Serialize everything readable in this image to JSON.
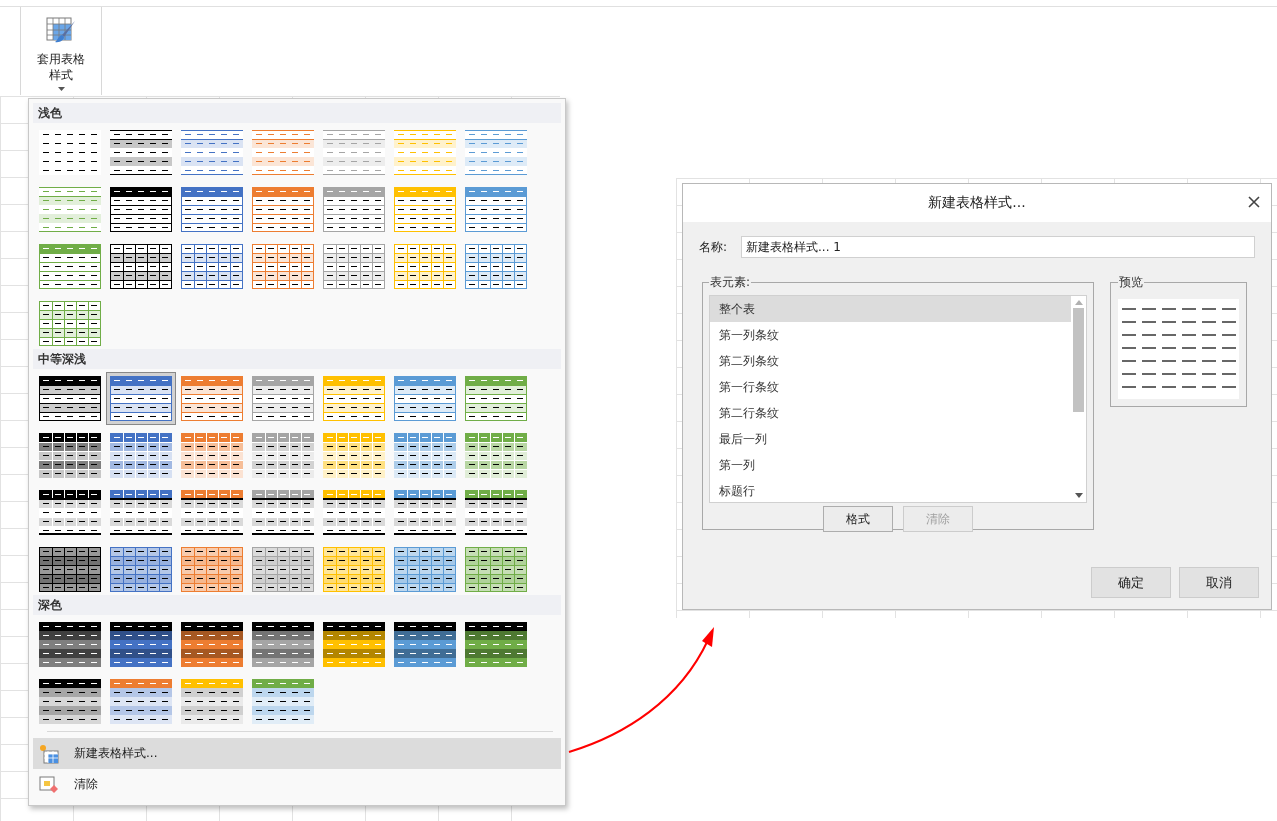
{
  "ribbon": {
    "button": {
      "label": "套用表格样式"
    }
  },
  "gallery": {
    "sections": [
      {
        "title": "浅色",
        "styles": [
          {
            "kind": "plain",
            "color": "#000000",
            "selected": false
          },
          {
            "kind": "light-banded",
            "color": "#000000",
            "selected": false
          },
          {
            "kind": "light-banded",
            "color": "#4472c4",
            "selected": false
          },
          {
            "kind": "light-banded",
            "color": "#ed7d31",
            "selected": false
          },
          {
            "kind": "light-banded",
            "color": "#a5a5a5",
            "selected": false
          },
          {
            "kind": "light-banded",
            "color": "#ffc000",
            "selected": false
          },
          {
            "kind": "light-banded",
            "color": "#5b9bd5",
            "selected": false
          },
          {
            "kind": "light-banded",
            "color": "#70ad47",
            "selected": false
          },
          {
            "kind": "lined",
            "color": "#000000",
            "selected": false
          },
          {
            "kind": "lined",
            "color": "#4472c4",
            "selected": false
          },
          {
            "kind": "lined",
            "color": "#ed7d31",
            "selected": false
          },
          {
            "kind": "lined",
            "color": "#a5a5a5",
            "selected": false
          },
          {
            "kind": "lined",
            "color": "#ffc000",
            "selected": false
          },
          {
            "kind": "lined",
            "color": "#5b9bd5",
            "selected": false
          },
          {
            "kind": "lined",
            "color": "#70ad47",
            "selected": false
          },
          {
            "kind": "grid",
            "color": "#000000",
            "selected": false
          },
          {
            "kind": "grid",
            "color": "#4472c4",
            "selected": false
          },
          {
            "kind": "grid",
            "color": "#ed7d31",
            "selected": false
          },
          {
            "kind": "grid",
            "color": "#a5a5a5",
            "selected": false
          },
          {
            "kind": "grid",
            "color": "#ffc000",
            "selected": false
          },
          {
            "kind": "grid",
            "color": "#5b9bd5",
            "selected": false
          },
          {
            "kind": "grid",
            "color": "#70ad47",
            "selected": false
          }
        ]
      },
      {
        "title": "中等深浅",
        "styles": [
          {
            "kind": "banded-header",
            "color": "#000000",
            "selected": false
          },
          {
            "kind": "banded-header",
            "color": "#4472c4",
            "selected": true
          },
          {
            "kind": "banded-header",
            "color": "#ed7d31",
            "selected": false
          },
          {
            "kind": "banded-header",
            "color": "#a5a5a5",
            "selected": false
          },
          {
            "kind": "banded-header",
            "color": "#ffc000",
            "selected": false
          },
          {
            "kind": "banded-header",
            "color": "#5b9bd5",
            "selected": false
          },
          {
            "kind": "banded-header",
            "color": "#70ad47",
            "selected": false
          },
          {
            "kind": "tinted-cells",
            "color": "#000000",
            "selected": false
          },
          {
            "kind": "tinted-cells",
            "color": "#4472c4",
            "selected": false
          },
          {
            "kind": "tinted-cells",
            "color": "#ed7d31",
            "selected": false
          },
          {
            "kind": "tinted-cells",
            "color": "#a5a5a5",
            "selected": false
          },
          {
            "kind": "tinted-cells",
            "color": "#ffc000",
            "selected": false
          },
          {
            "kind": "tinted-cells",
            "color": "#5b9bd5",
            "selected": false
          },
          {
            "kind": "tinted-cells",
            "color": "#70ad47",
            "selected": false
          },
          {
            "kind": "grey-grid",
            "color": "#000000",
            "selected": false
          },
          {
            "kind": "grey-grid",
            "color": "#4472c4",
            "selected": false
          },
          {
            "kind": "grey-grid",
            "color": "#ed7d31",
            "selected": false
          },
          {
            "kind": "grey-grid",
            "color": "#a5a5a5",
            "selected": false
          },
          {
            "kind": "grey-grid",
            "color": "#ffc000",
            "selected": false
          },
          {
            "kind": "grey-grid",
            "color": "#5b9bd5",
            "selected": false
          },
          {
            "kind": "grey-grid",
            "color": "#70ad47",
            "selected": false
          },
          {
            "kind": "tinted-grid",
            "color": "#000000",
            "selected": false
          },
          {
            "kind": "tinted-grid",
            "color": "#4472c4",
            "selected": false
          },
          {
            "kind": "tinted-grid",
            "color": "#ed7d31",
            "selected": false
          },
          {
            "kind": "tinted-grid",
            "color": "#a5a5a5",
            "selected": false
          },
          {
            "kind": "tinted-grid",
            "color": "#ffc000",
            "selected": false
          },
          {
            "kind": "tinted-grid",
            "color": "#5b9bd5",
            "selected": false
          },
          {
            "kind": "tinted-grid",
            "color": "#70ad47",
            "selected": false
          }
        ]
      },
      {
        "title": "深色",
        "styles": [
          {
            "kind": "dark-banded",
            "color": "#000000",
            "selected": false
          },
          {
            "kind": "dark-banded",
            "color": "#4472c4",
            "selected": false
          },
          {
            "kind": "dark-banded",
            "color": "#ed7d31",
            "selected": false
          },
          {
            "kind": "dark-banded",
            "color": "#a5a5a5",
            "selected": false
          },
          {
            "kind": "dark-banded",
            "color": "#ffc000",
            "selected": false
          },
          {
            "kind": "dark-banded",
            "color": "#5b9bd5",
            "selected": false
          },
          {
            "kind": "dark-banded",
            "color": "#70ad47",
            "selected": false
          },
          {
            "kind": "dark-header",
            "color": "#000000",
            "band": {
              "color": "#a6a6a6"
            },
            "selected": false
          },
          {
            "kind": "dark-header",
            "color": "#ed7d31",
            "band": {
              "color": "#b4c6e7"
            },
            "selected": false
          },
          {
            "kind": "dark-header",
            "color": "#ffc000",
            "band": {
              "color": "#d0d0d0"
            },
            "selected": false
          },
          {
            "kind": "dark-header",
            "color": "#70ad47",
            "band": {
              "color": "#bdd7ee"
            },
            "selected": false
          }
        ]
      }
    ],
    "menu_items": [
      {
        "kind": "new",
        "label": "新建表格样式...",
        "selected": true
      },
      {
        "kind": "clear",
        "label": "清除",
        "selected": false
      }
    ]
  },
  "dialog": {
    "title": "新建表格样式...",
    "name_label": "名称:",
    "name_value": "新建表格样式... 1",
    "elements_group": "表元素:",
    "elements": [
      {
        "label": "整个表",
        "selected": true
      },
      {
        "label": "第一列条纹",
        "selected": false
      },
      {
        "label": "第二列条纹",
        "selected": false
      },
      {
        "label": "第一行条纹",
        "selected": false
      },
      {
        "label": "第二行条纹",
        "selected": false
      },
      {
        "label": "最后一列",
        "selected": false
      },
      {
        "label": "第一列",
        "selected": false
      },
      {
        "label": "标题行",
        "selected": false
      }
    ],
    "format_button": {
      "label": "格式",
      "disabled": false
    },
    "clear_button": {
      "label": "清除",
      "disabled": true
    },
    "preview_group": "预览",
    "ok_button": "确定",
    "cancel_button": "取消"
  }
}
